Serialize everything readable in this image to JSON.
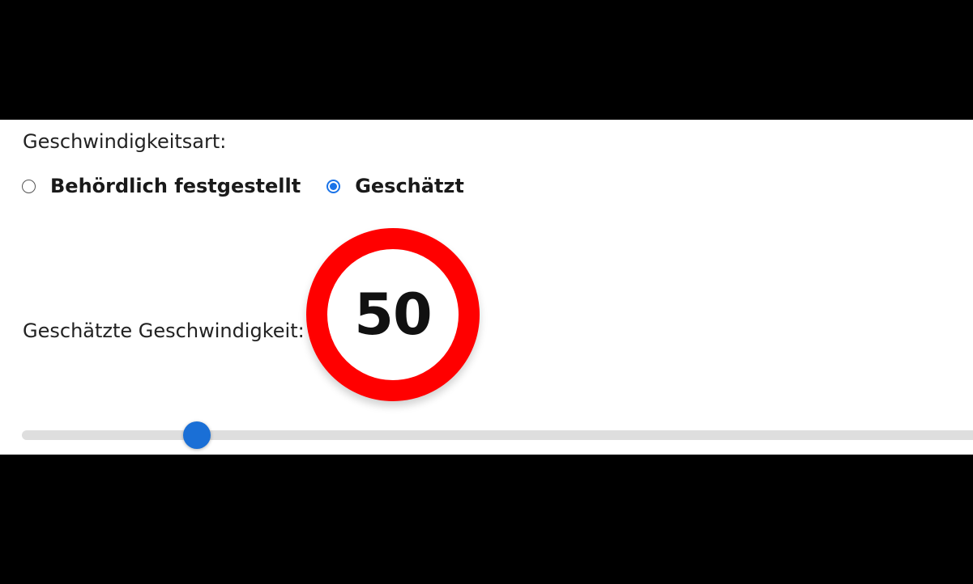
{
  "speed_type": {
    "label": "Geschwindigkeitsart:",
    "options": [
      {
        "label": "Behördlich festgestellt",
        "selected": false
      },
      {
        "label": "Geschätzt",
        "selected": true
      }
    ]
  },
  "estimated_speed": {
    "label": "Geschätzte Geschwindigkeit:",
    "value": "50",
    "slider_fraction": 0.18
  },
  "colors": {
    "accent": "#1a73e8",
    "sign_ring": "#ff0000",
    "slider_thumb": "#1a6fd6",
    "slider_track": "#dedede"
  }
}
